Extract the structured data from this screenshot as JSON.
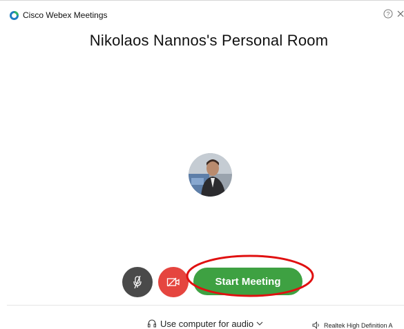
{
  "window": {
    "title": "Cisco Webex Meetings",
    "help_icon": "help-icon",
    "close_icon": "close-icon"
  },
  "room": {
    "title": "Nikolaos Nannos's Personal Room"
  },
  "controls": {
    "mute_icon": "microphone-muted-icon",
    "video_icon": "video-off-icon",
    "start_label": "Start Meeting"
  },
  "audio": {
    "option_label": "Use computer for audio",
    "speaker_label": "Realtek High Definition A"
  },
  "colors": {
    "start_button": "#3ea142",
    "video_button": "#e5453f",
    "mute_button": "#4a4a4a",
    "highlight_ring": "#e01010"
  }
}
